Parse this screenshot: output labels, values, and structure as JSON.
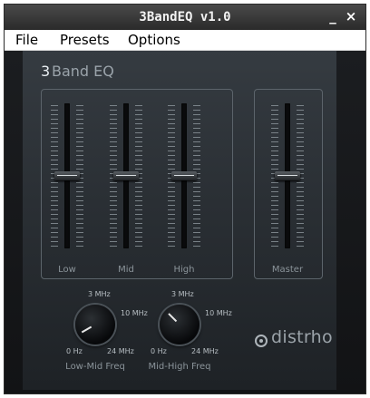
{
  "window": {
    "title": "3BandEQ v1.0",
    "minimize_icon": "minimize-icon",
    "close_icon": "close-icon",
    "minimize": "_",
    "close": "×"
  },
  "menu": {
    "items": [
      "File",
      "Presets",
      "Options"
    ]
  },
  "plugin": {
    "brand_number": "3",
    "brand_text": "Band EQ",
    "faders": [
      {
        "label": "Low",
        "level": 0.5
      },
      {
        "label": "Mid",
        "level": 0.5
      },
      {
        "label": "High",
        "level": 0.5
      },
      {
        "label": "Master",
        "level": 0.5
      }
    ],
    "knobs": [
      {
        "label": "Low-Mid Freq",
        "tick_top": "3 MHz",
        "tick_right": "10 MHz",
        "tick_min": "0 Hz",
        "tick_max": "24 MHz"
      },
      {
        "label": "Mid-High Freq",
        "tick_top": "3 MHz",
        "tick_right": "10 MHz",
        "tick_min": "0 Hz",
        "tick_max": "24 MHz"
      }
    ],
    "logo_text": "distrho",
    "logo_icon": "distrho-logo-icon"
  }
}
